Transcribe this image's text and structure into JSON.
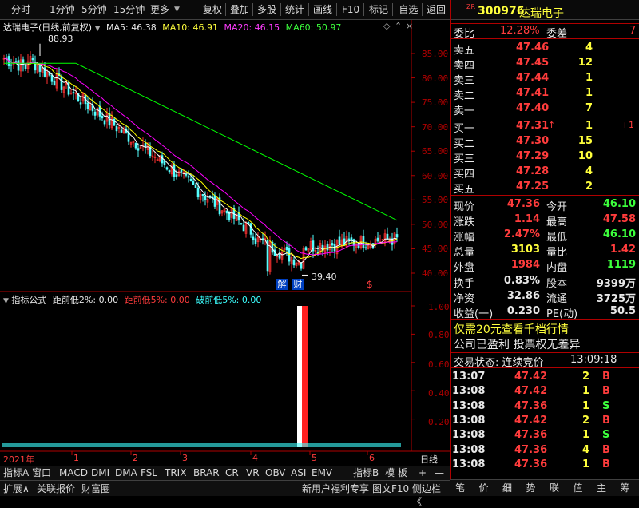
{
  "toolbar": {
    "left": [
      "分时",
      "1分钟",
      "5分钟",
      "15分钟",
      "更多"
    ],
    "right": [
      "复权",
      "叠加",
      "多股",
      "统计",
      "画线",
      "F10",
      "标记",
      "-自选",
      "返回"
    ]
  },
  "chart": {
    "title": "达瑞电子(日线,前复权)",
    "ma5_label": "MA5: 46.38",
    "ma10_label": "MA10: 46.91",
    "ma20_label": "MA20: 46.15",
    "ma60_label": "MA60: 50.97",
    "high_label": "88.93",
    "low_label": "39.40",
    "event1": "解",
    "event2": "财",
    "event3": "$",
    "price_ticks": [
      "85.00",
      "80.00",
      "75.00",
      "70.00",
      "65.00",
      "60.00",
      "55.00",
      "50.00",
      "45.00",
      "40.00"
    ],
    "colors": {
      "ma5": "#ffffff",
      "ma10": "#ffff00",
      "ma20": "#ff00ff",
      "ma60": "#00ff00",
      "up": "#ff3232",
      "down": "#54ffff"
    }
  },
  "indicator": {
    "name": "指标公式",
    "label1": "距前低2%: 0.00",
    "label2": "距前低5%: 0.00",
    "label3": "破前低5%: 0.00",
    "ticks": [
      "1.00",
      "0.80",
      "0.60",
      "0.40",
      "0.20"
    ]
  },
  "axis": {
    "labels": [
      "2021年",
      "1",
      "2",
      "3",
      "4",
      "5",
      "6"
    ],
    "period": "日线"
  },
  "tabs_row1": [
    "指标A",
    "窗口",
    "MACD",
    "DMI",
    "DMA",
    "FSL",
    "TRIX",
    "BRAR",
    "CR",
    "VR",
    "OBV",
    "ASI",
    "EMV",
    "指标B",
    "模 板",
    "+",
    "—"
  ],
  "tabs_row2": [
    "扩展∧",
    "关联报价",
    "财富圈"
  ],
  "tabs_row2_right": [
    "新用户福利专享",
    "图文F10",
    "侧边栏《"
  ],
  "panel": {
    "code_prefix": "ZR",
    "code": "300976",
    "name": "达瑞电子",
    "webi_label": "委比",
    "webi_value": "12.28%",
    "weicha_label": "委差",
    "weicha_value": "7",
    "asks": [
      {
        "label": "卖五",
        "price": "47.46",
        "vol": "4"
      },
      {
        "label": "卖四",
        "price": "47.45",
        "vol": "12"
      },
      {
        "label": "卖三",
        "price": "47.44",
        "vol": "1"
      },
      {
        "label": "卖二",
        "price": "47.41",
        "vol": "1"
      },
      {
        "label": "卖一",
        "price": "47.40",
        "vol": "7"
      }
    ],
    "bids": [
      {
        "label": "买一",
        "price": "47.31",
        "vol": "1",
        "extra": "+1"
      },
      {
        "label": "买二",
        "price": "47.30",
        "vol": "15",
        "extra": ""
      },
      {
        "label": "买三",
        "price": "47.29",
        "vol": "10",
        "extra": ""
      },
      {
        "label": "买四",
        "price": "47.28",
        "vol": "4",
        "extra": ""
      },
      {
        "label": "买五",
        "price": "47.25",
        "vol": "2",
        "extra": ""
      }
    ],
    "stats": [
      {
        "l1": "现价",
        "v1": "47.36",
        "l2": "今开",
        "v2": "46.10"
      },
      {
        "l1": "涨跌",
        "v1": "1.14",
        "l2": "最高",
        "v2": "47.58"
      },
      {
        "l1": "涨幅",
        "v1": "2.47%",
        "l2": "最低",
        "v2": "46.10"
      },
      {
        "l1": "总量",
        "v1": "3103",
        "l2": "量比",
        "v2": "1.42"
      },
      {
        "l1": "外盘",
        "v1": "1984",
        "l2": "内盘",
        "v2": "1119"
      }
    ],
    "stats2": [
      {
        "l1": "换手",
        "v1": "0.83%",
        "l2": "股本",
        "v2": "9399万"
      },
      {
        "l1": "净资",
        "v1": "32.86",
        "l2": "流通",
        "v2": "3725万"
      },
      {
        "l1": "收益(一)",
        "v1": "0.230",
        "l2": "PE(动)",
        "v2": "50.5"
      }
    ],
    "promo": "仅需20元查看千档行情",
    "note": "公司已盈利 投票权无差异",
    "trade_status": "交易状态: 连续竞价",
    "trade_time": "13:09:18",
    "trades": [
      {
        "time": "13:07",
        "price": "47.42",
        "vol": "2",
        "side": "B"
      },
      {
        "time": "13:08",
        "price": "47.42",
        "vol": "1",
        "side": "B"
      },
      {
        "time": "13:08",
        "price": "47.36",
        "vol": "1",
        "side": "S"
      },
      {
        "time": "13:08",
        "price": "47.42",
        "vol": "2",
        "side": "B"
      },
      {
        "time": "13:08",
        "price": "47.36",
        "vol": "1",
        "side": "S"
      },
      {
        "time": "13:08",
        "price": "47.36",
        "vol": "4",
        "side": "B"
      },
      {
        "time": "13:08",
        "price": "47.36",
        "vol": "1",
        "side": "B"
      }
    ],
    "bottom_tabs": [
      "笔",
      "价",
      "细",
      "势",
      "联",
      "值",
      "主",
      "筹"
    ]
  }
}
